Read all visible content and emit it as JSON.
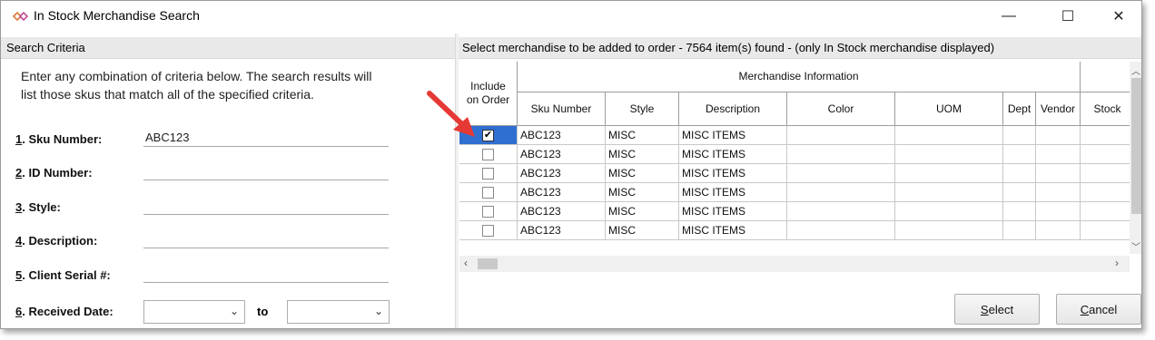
{
  "window": {
    "title": "In Stock Merchandise Search",
    "icon": "diamond-link-icon",
    "controls": {
      "minimize": "—",
      "maximize": "☐",
      "close": "✕"
    }
  },
  "left_panel": {
    "header": "Search Criteria",
    "instructions": "Enter any combination of criteria below.  The search results will list those skus that match all of the specified criteria.",
    "fields": [
      {
        "num": "1",
        "label": ". Sku Number:",
        "value": "ABC123"
      },
      {
        "num": "2",
        "label": ". ID Number:",
        "value": ""
      },
      {
        "num": "3",
        "label": ". Style:",
        "value": ""
      },
      {
        "num": "4",
        "label": ". Description:",
        "value": ""
      },
      {
        "num": "5",
        "label": ". Client Serial #:",
        "value": ""
      },
      {
        "num": "6",
        "label": ". Received Date:",
        "value": ""
      }
    ],
    "date_to_label": "to"
  },
  "right_panel": {
    "header": "Select merchandise to be added to order - 7564 item(s) found - (only In Stock merchandise displayed)",
    "grid": {
      "include_header": "Include on Order",
      "group_header": "Merchandise Information",
      "columns": [
        "Sku Number",
        "Style",
        "Description",
        "Color",
        "UOM",
        "Dept",
        "Vendor",
        "Stock"
      ],
      "rows": [
        {
          "checked": true,
          "sku": "ABC123",
          "style": "MISC",
          "description": "MISC ITEMS"
        },
        {
          "checked": false,
          "sku": "ABC123",
          "style": "MISC",
          "description": "MISC ITEMS"
        },
        {
          "checked": false,
          "sku": "ABC123",
          "style": "MISC",
          "description": "MISC ITEMS"
        },
        {
          "checked": false,
          "sku": "ABC123",
          "style": "MISC",
          "description": "MISC ITEMS"
        },
        {
          "checked": false,
          "sku": "ABC123",
          "style": "MISC",
          "description": "MISC ITEMS"
        },
        {
          "checked": false,
          "sku": "ABC123",
          "style": "MISC",
          "description": "MISC ITEMS"
        }
      ]
    },
    "buttons": {
      "select": {
        "accel": "S",
        "rest": "elect"
      },
      "cancel": {
        "accel": "C",
        "rest": "ancel"
      }
    }
  },
  "colors": {
    "selection": "#2f6fd1",
    "annotation_arrow": "#e53935",
    "panel_header": "#e9e9e9"
  }
}
